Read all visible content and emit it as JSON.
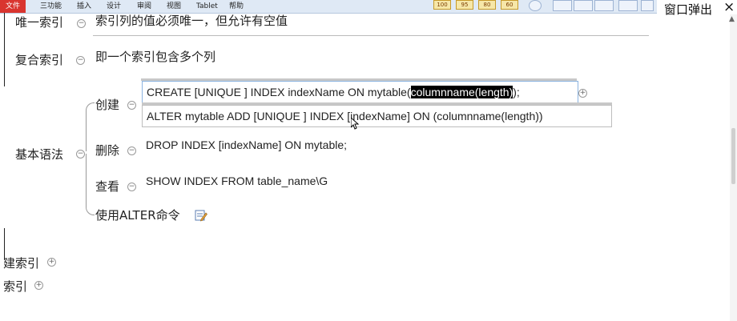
{
  "menubar": {
    "tabs": [
      "文件",
      "三功能",
      "插入",
      "设计",
      "审阅",
      "视图",
      "Tablet",
      "帮助"
    ],
    "zoom_buttons": [
      "100",
      "95",
      "80",
      "60"
    ]
  },
  "window": {
    "title": "窗口弹出",
    "close_glyph": "×"
  },
  "mindmap": {
    "top_cut_node": "唯一索引",
    "top_cut_desc": "索引列的值必须唯一，但允许有空值",
    "composite": {
      "label": "复合索引",
      "desc": "即一个索引包含多个列"
    },
    "basic_syntax": {
      "label": "基本语法",
      "create": {
        "label": "创建",
        "code1_pre": "CREATE  [UNIQUE ] INDEX indexName ON mytable(",
        "code1_sel": "columnname(length)",
        "code1_post": ");",
        "code2": "ALTER mytable ADD  [UNIQUE ]  INDEX [indexName] ON (columnname(length))"
      },
      "delete": {
        "label": "删除",
        "code": "DROP INDEX [indexName] ON mytable;"
      },
      "view": {
        "label": "查看",
        "code": "SHOW INDEX FROM table_name\\G"
      },
      "alter": {
        "label": "使用ALTER命令"
      }
    },
    "bottom1": "建索引",
    "bottom2": "索引"
  },
  "toggles": {
    "collapse": "−",
    "expand": "+"
  }
}
